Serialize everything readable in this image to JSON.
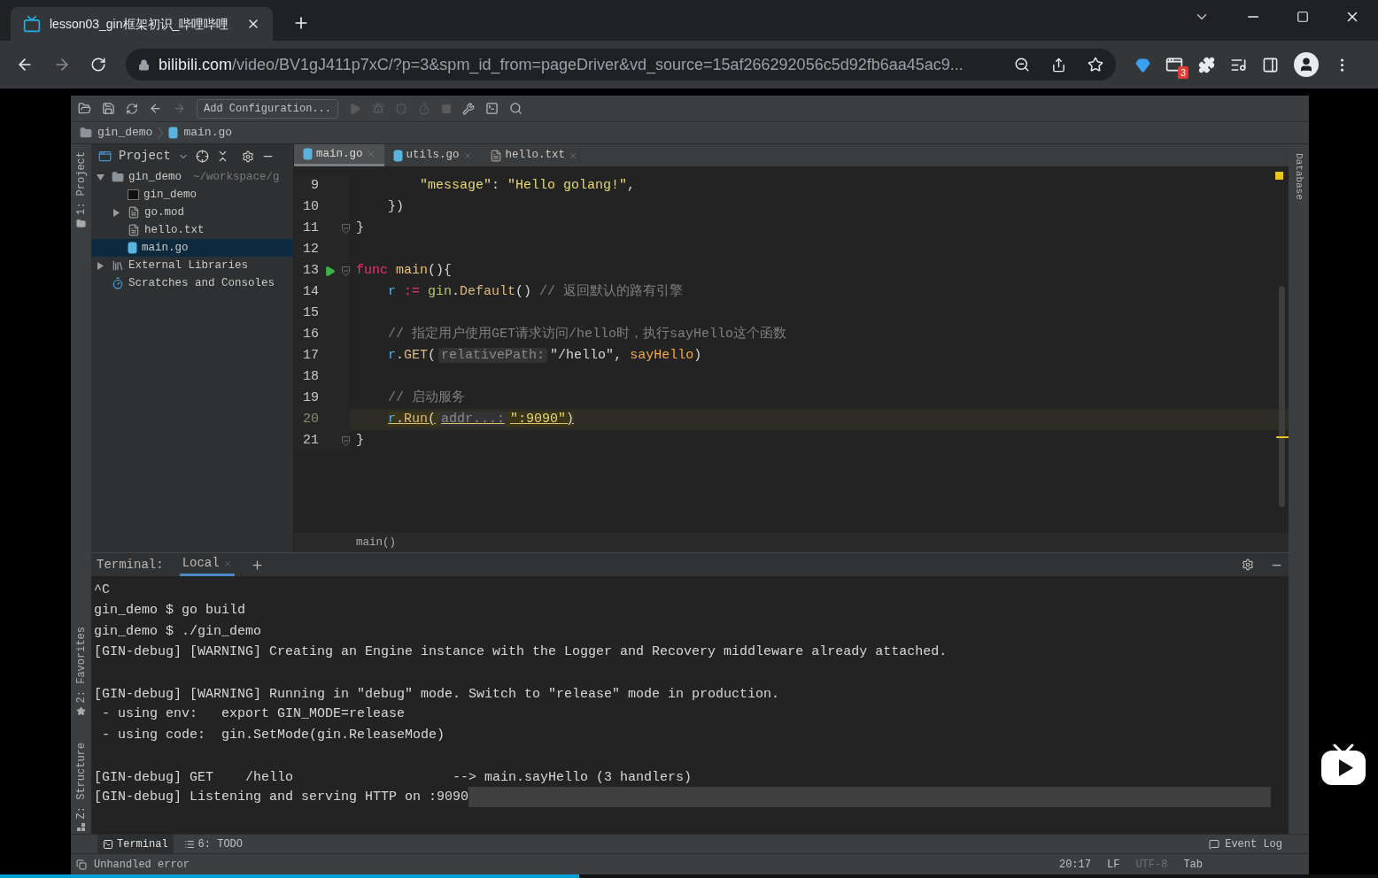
{
  "browser": {
    "tab": {
      "title": "lesson03_gin框架初识_哔哩哔哩",
      "selected": true
    },
    "address": {
      "host": "bilibili.com",
      "path": "/video/BV1gJ411p7xC/?p=3&spm_id_from=pageDriver&vd_source=15af266292056c5d92fb6aa45ac9..."
    },
    "extension_badge": "3"
  },
  "ide": {
    "toolbar": {
      "run_config": "Add Configuration..."
    },
    "breadcrumb": [
      {
        "label": "gin_demo",
        "kind": "folder"
      },
      {
        "label": "main.go",
        "kind": "go"
      }
    ],
    "left_stripe": [
      "1: Project",
      "2: Favorites",
      "Z: Structure"
    ],
    "right_stripe": [
      "Database"
    ],
    "project": {
      "title": "Project",
      "tree": [
        {
          "label": "gin_demo",
          "kind": "folder",
          "path": "~/workspace/g",
          "expandable": true,
          "expanded": true,
          "selected": false,
          "children": [
            {
              "label": "gin_demo",
              "kind": "binary",
              "expandable": false,
              "selected": false
            },
            {
              "label": "go.mod",
              "kind": "text",
              "expandable": true,
              "expanded": false,
              "selected": false
            },
            {
              "label": "hello.txt",
              "kind": "text",
              "expandable": false,
              "selected": false
            },
            {
              "label": "main.go",
              "kind": "go",
              "expandable": false,
              "selected": true
            }
          ]
        },
        {
          "label": "External Libraries",
          "kind": "library",
          "expandable": true,
          "expanded": false,
          "selected": false
        },
        {
          "label": "Scratches and Consoles",
          "kind": "scratch",
          "expandable": false,
          "selected": false
        }
      ]
    },
    "editor": {
      "tabs": [
        {
          "label": "main.go",
          "kind": "go",
          "selected": true
        },
        {
          "label": "utils.go",
          "kind": "go",
          "selected": false
        },
        {
          "label": "hello.txt",
          "kind": "text",
          "selected": false
        }
      ],
      "lines": [
        {
          "number": "9",
          "current": false,
          "run": false,
          "fold": false,
          "warning": false,
          "tokens": [
            {
              "text": "        \"message\"",
              "kind": "string"
            },
            {
              "text": ": ",
              "kind": "plain"
            },
            {
              "text": "\"Hello golang!\"",
              "kind": "string"
            },
            {
              "text": ",",
              "kind": "plain"
            }
          ]
        },
        {
          "number": "10",
          "current": false,
          "run": false,
          "fold": false,
          "warning": false,
          "tokens": [
            {
              "text": "    })",
              "kind": "plain"
            }
          ]
        },
        {
          "number": "11",
          "current": false,
          "run": false,
          "fold": true,
          "warning": false,
          "tokens": [
            {
              "text": "}",
              "kind": "plain"
            }
          ]
        },
        {
          "number": "12",
          "current": false,
          "run": false,
          "fold": false
        },
        {
          "number": "13",
          "current": false,
          "run": true,
          "fold": true,
          "warning": false,
          "tokens": [
            {
              "text": "func ",
              "kind": "keyword"
            },
            {
              "text": "main",
              "kind": "function"
            },
            {
              "text": "(){",
              "kind": "plain"
            }
          ]
        },
        {
          "number": "14",
          "current": false,
          "run": false,
          "fold": false,
          "warning": false,
          "tokens": [
            {
              "text": "    r",
              "kind": "variable"
            },
            {
              "text": " := ",
              "kind": "keyword"
            },
            {
              "text": "gin",
              "kind": "package"
            },
            {
              "text": ".",
              "kind": "plain"
            },
            {
              "text": "Default",
              "kind": "method"
            },
            {
              "text": "() ",
              "kind": "plain"
            },
            {
              "text": "// 返回默认的路有引擎",
              "kind": "comment"
            }
          ]
        },
        {
          "number": "15",
          "current": false,
          "run": false,
          "fold": false
        },
        {
          "number": "16",
          "current": false,
          "run": false,
          "fold": false,
          "warning": false,
          "tokens": [
            {
              "text": "    // 指定用户使用GET请求访问/hello时，执行sayHello这个函数",
              "kind": "comment"
            }
          ]
        },
        {
          "number": "17",
          "current": false,
          "run": false,
          "fold": false,
          "warning": false,
          "tokens": [
            {
              "text": "    r",
              "kind": "variable"
            },
            {
              "text": ".",
              "kind": "plain"
            },
            {
              "text": "GET",
              "kind": "method"
            },
            {
              "text": "(",
              "kind": "plain"
            },
            {
              "text": "relativePath:",
              "kind": "hint"
            },
            {
              "text": "\"/hello\"",
              "kind": "plain"
            },
            {
              "text": ", ",
              "kind": "plain"
            },
            {
              "text": "sayHello",
              "kind": "reference"
            },
            {
              "text": ")",
              "kind": "plain"
            }
          ]
        },
        {
          "number": "18",
          "current": false,
          "run": false,
          "fold": false
        },
        {
          "number": "19",
          "current": false,
          "run": false,
          "fold": false,
          "warning": false,
          "tokens": [
            {
              "text": "    // 启动服务",
              "kind": "comment"
            }
          ]
        },
        {
          "number": "20",
          "current": true,
          "run": false,
          "fold": false,
          "warning": true,
          "tokens": [
            {
              "text": "    r",
              "kind": "variable"
            },
            {
              "text": ".",
              "kind": "plain"
            },
            {
              "text": "Run",
              "kind": "method"
            },
            {
              "text": "(",
              "kind": "plain"
            },
            {
              "text": "addr...:",
              "kind": "hint"
            },
            {
              "text": "\":9090\"",
              "kind": "string"
            },
            {
              "text": ")",
              "kind": "plain"
            }
          ]
        },
        {
          "number": "21",
          "current": false,
          "run": false,
          "fold": true,
          "warning": false,
          "tokens": [
            {
              "text": "}",
              "kind": "plain"
            }
          ]
        }
      ],
      "breadcrumb": "main()"
    },
    "terminal": {
      "label": "Terminal:",
      "tabs": [
        {
          "label": "Local",
          "selected": true
        }
      ],
      "lines": [
        {
          "text": "^C",
          "spaced": false,
          "current": false
        },
        {
          "text": "gin_demo $ go build",
          "spaced": false,
          "current": false
        },
        {
          "text": "gin_demo $ ./gin_demo",
          "spaced": false,
          "current": false
        },
        {
          "text": "[GIN-debug] [WARNING] Creating an Engine instance with the Logger and Recovery middleware already attached.",
          "spaced": false,
          "current": false
        },
        {
          "text": "[GIN-debug] [WARNING] Running in \"debug\" mode. Switch to \"release\" mode in production.",
          "spaced": true,
          "current": false
        },
        {
          "text": " - using env:   export GIN_MODE=release",
          "spaced": false,
          "current": false
        },
        {
          "text": " - using code:  gin.SetMode(gin.ReleaseMode)",
          "spaced": false,
          "current": false
        },
        {
          "text": "[GIN-debug] GET    /hello                    --> main.sayHello (3 handlers)",
          "spaced": true,
          "current": false
        },
        {
          "text": "[GIN-debug] Listening and serving HTTP on :9090",
          "spaced": false,
          "current": true
        }
      ]
    },
    "tool_windows": [
      {
        "label": "Terminal",
        "kind": "terminal",
        "selected": true
      },
      {
        "label": "6: TODO",
        "kind": "todo",
        "selected": false
      }
    ],
    "event_log": "Event Log",
    "status": {
      "message": "Unhandled error",
      "items": [
        {
          "text": "20:17",
          "dim": false
        },
        {
          "text": "LF",
          "dim": false
        },
        {
          "text": "UTF-8",
          "dim": true
        },
        {
          "text": "Tab",
          "dim": false
        }
      ]
    }
  },
  "video": {
    "progress": {
      "level": 0.42
    }
  }
}
